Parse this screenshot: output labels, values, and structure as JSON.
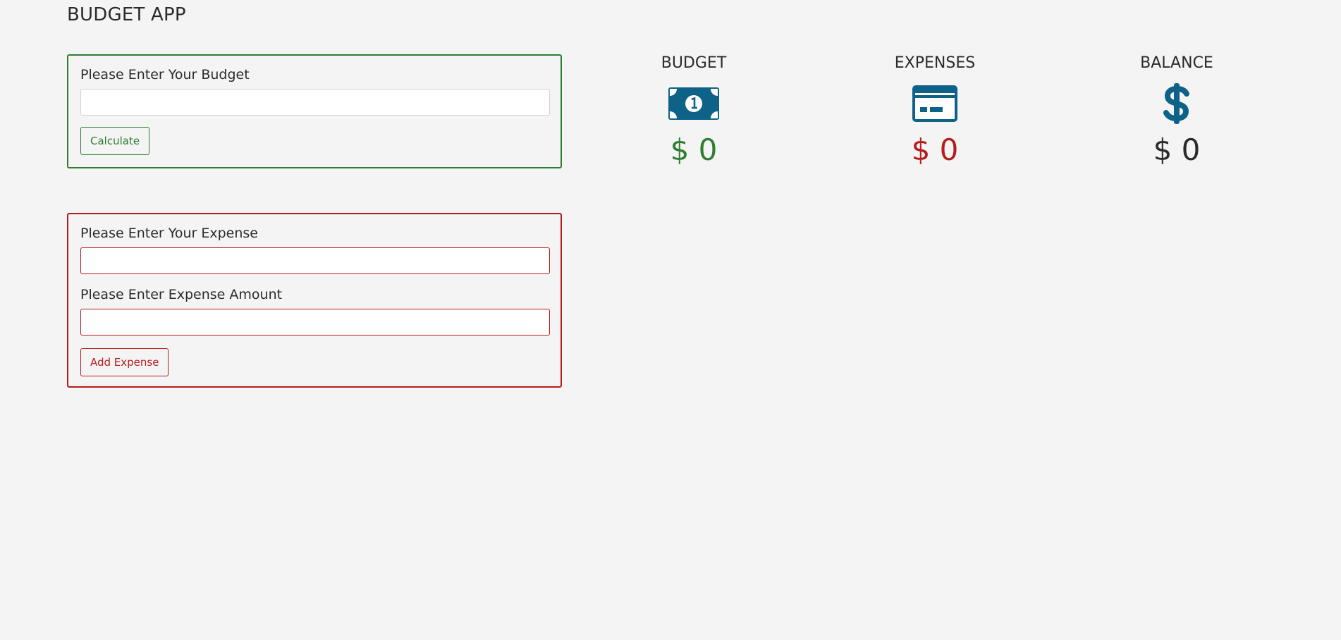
{
  "app": {
    "title": "BUDGET APP"
  },
  "budget_form": {
    "label": "Please Enter Your Budget",
    "input_value": "",
    "button_label": "Calculate"
  },
  "expense_form": {
    "expense_label": "Please Enter Your Expense",
    "expense_value": "",
    "amount_label": "Please Enter Expense Amount",
    "amount_value": "",
    "button_label": "Add Expense"
  },
  "summary": {
    "budget": {
      "title": "BUDGET",
      "currency": "$",
      "amount": "0",
      "icon": "money-bill-icon"
    },
    "expenses": {
      "title": "EXPENSES",
      "currency": "$",
      "amount": "0",
      "icon": "credit-card-icon"
    },
    "balance": {
      "title": "BALANCE",
      "currency": "$",
      "amount": "0",
      "icon": "dollar-sign-icon"
    }
  },
  "colors": {
    "background": "#f4f4f4",
    "budget_accent": "#2e7d32",
    "expense_accent": "#b71c1c",
    "icon": "#0e6288",
    "text": "#2b2b2b"
  }
}
